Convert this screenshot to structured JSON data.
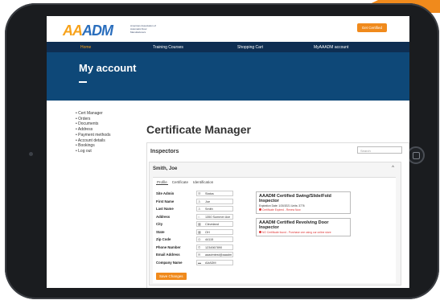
{
  "header": {
    "logo_a": "AA",
    "logo_b": "ADM",
    "logo_sub": "American Association of Automatic Door Manufacturers",
    "get_certified": "Get Certified"
  },
  "nav": {
    "items": [
      "Home",
      "Training Courses",
      "Shopping Cart",
      "MyAAADM account"
    ]
  },
  "banner": {
    "title": "My account"
  },
  "account_menu": [
    "Cert Manager",
    "Orders",
    "Documents",
    "Address",
    "Payment methods",
    "Account details",
    "Bookings",
    "Log out"
  ],
  "page_title": "Certificate Manager",
  "inspectors": {
    "title": "Inspectors",
    "search_placeholder": "Search",
    "person_name": "Smith, Joe",
    "tabs": [
      "Profile",
      "Certificate",
      "Identification"
    ],
    "fields": [
      {
        "label": "Site Admin",
        "value": "Status"
      },
      {
        "label": "First Name",
        "value": "Joe"
      },
      {
        "label": "Last Name",
        "value": "Smith"
      },
      {
        "label": "Address",
        "value": "1350 Summer Ave"
      },
      {
        "label": "City",
        "value": "Cleveland"
      },
      {
        "label": "State",
        "value": "OH"
      },
      {
        "label": "Zip Code",
        "value": "44115"
      },
      {
        "label": "Phone Number",
        "value": "1234567890"
      },
      {
        "label": "Email Address",
        "value": "aaadmtest@aaadm"
      },
      {
        "label": "Company Name",
        "value": "AAADM"
      }
    ],
    "save_label": "Save Changes",
    "certs": [
      {
        "title": "AAADM Certified Swing/Slide/Fold Inspector",
        "meta": "Expiration Date: 1/30/2021  Units: 3776",
        "error": "Certificate Expired - Renew Now"
      },
      {
        "title": "AAADM Certified Revolving Door Inspector",
        "meta": "",
        "error": "NO Certificate found - Purchase one using our online store"
      }
    ]
  }
}
